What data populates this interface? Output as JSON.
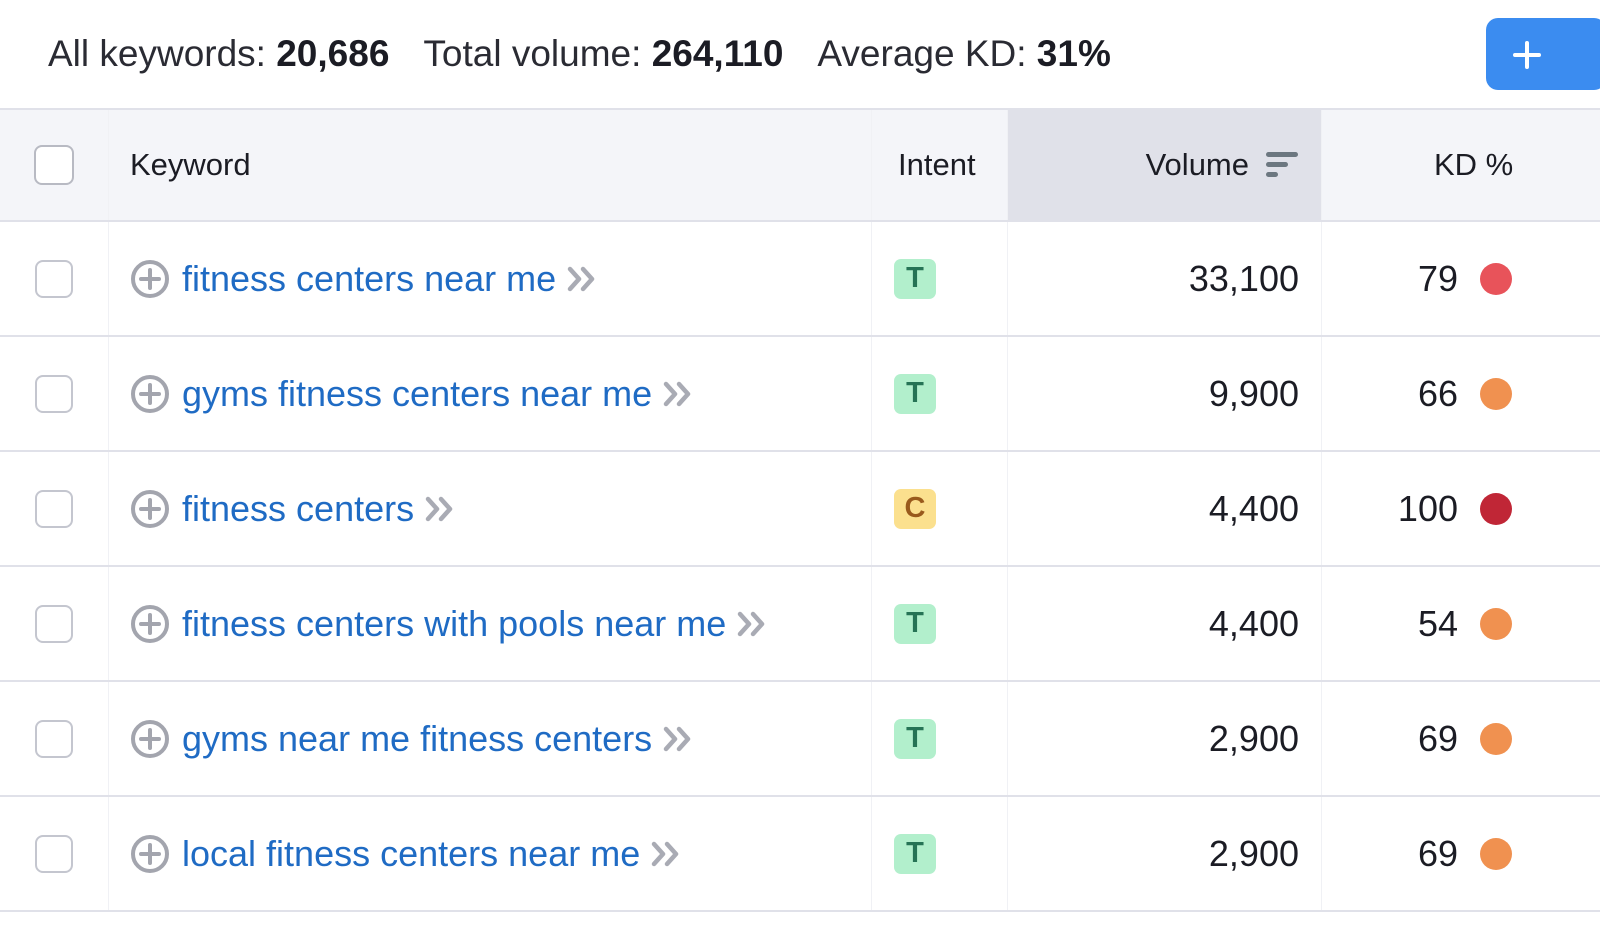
{
  "summary": {
    "all_keywords_label": "All keywords:",
    "all_keywords_value": "20,686",
    "total_volume_label": "Total volume:",
    "total_volume_value": "264,110",
    "average_kd_label": "Average KD:",
    "average_kd_value": "31%"
  },
  "toolbar": {
    "add_button_icon": "plus-icon"
  },
  "table": {
    "columns": {
      "keyword": "Keyword",
      "intent": "Intent",
      "volume": "Volume",
      "kd": "KD %"
    },
    "sorted_by": "Volume",
    "sort_icon": "sort-descending-icon",
    "rows": [
      {
        "keyword": "fitness centers near me",
        "intent": "T",
        "volume": "33,100",
        "kd": "79",
        "kd_color": "#e8535a"
      },
      {
        "keyword": "gyms fitness centers near me",
        "intent": "T",
        "volume": "9,900",
        "kd": "66",
        "kd_color": "#f09150"
      },
      {
        "keyword": "fitness centers",
        "intent": "C",
        "volume": "4,400",
        "kd": "100",
        "kd_color": "#c02636"
      },
      {
        "keyword": "fitness centers with pools near me",
        "intent": "T",
        "volume": "4,400",
        "kd": "54",
        "kd_color": "#f09150"
      },
      {
        "keyword": "gyms near me fitness centers",
        "intent": "T",
        "volume": "2,900",
        "kd": "69",
        "kd_color": "#f09150"
      },
      {
        "keyword": "local fitness centers near me",
        "intent": "T",
        "volume": "2,900",
        "kd": "69",
        "kd_color": "#f09150"
      }
    ]
  },
  "intent_styles": {
    "T": {
      "bg": "#b2efcc",
      "fg": "#267355"
    },
    "C": {
      "bg": "#fbe08e",
      "fg": "#995a1c"
    }
  }
}
